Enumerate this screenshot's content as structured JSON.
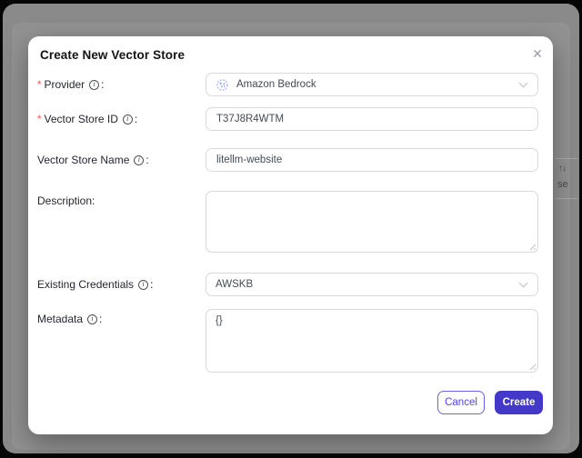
{
  "background": {
    "sort_icon": "↑↓",
    "partial_text": "se"
  },
  "modal": {
    "title": "Create New Vector Store",
    "close_icon": "✕",
    "fields": {
      "provider": {
        "required": "*",
        "label": "Provider",
        "colon": ":",
        "value": "Amazon Bedrock",
        "icon": "amazon-bedrock-logo"
      },
      "vector_store_id": {
        "required": "*",
        "label": "Vector Store ID",
        "colon": ":",
        "value": "T37J8R4WTM"
      },
      "vector_store_name": {
        "label": "Vector Store Name",
        "colon": ":",
        "value": "litellm-website"
      },
      "description": {
        "label": "Description",
        "colon": ":",
        "value": ""
      },
      "existing_credentials": {
        "label": "Existing Credentials",
        "colon": ":",
        "value": "AWSKB"
      },
      "metadata": {
        "label": "Metadata",
        "colon": ":",
        "value": "{}"
      }
    },
    "footer": {
      "cancel_label": "Cancel",
      "create_label": "Create"
    }
  },
  "icons": {
    "info": "i"
  },
  "colors": {
    "accent": "#4438c9",
    "accent_text": "#4f46e5",
    "required_asterisk": "#ff4d4f",
    "input_border": "#d9d9d9",
    "backdrop": "#8a8a8a"
  }
}
